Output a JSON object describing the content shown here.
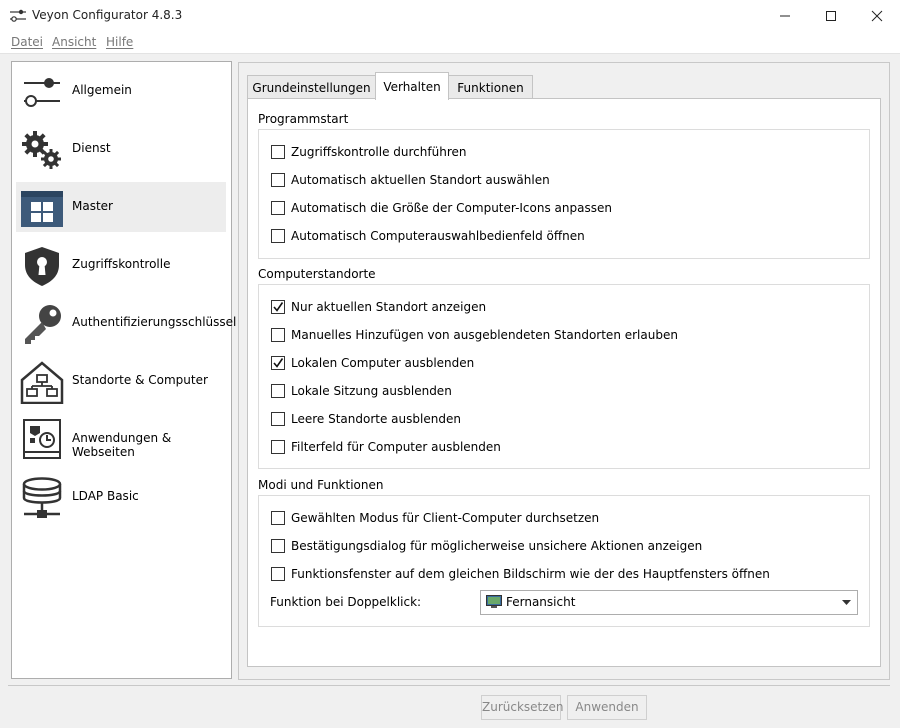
{
  "window": {
    "title": "Veyon Configurator 4.8.3"
  },
  "menu": [
    "Datei",
    "Ansicht",
    "Hilfe"
  ],
  "sidebar": {
    "items": [
      {
        "label": "Allgemein",
        "icon": "sliders-icon"
      },
      {
        "label": "Dienst",
        "icon": "gears-icon"
      },
      {
        "label": "Master",
        "icon": "master-grid-icon",
        "selected": true
      },
      {
        "label": "Zugriffskontrolle",
        "icon": "shield-keyhole-icon"
      },
      {
        "label": "Authentifizierungsschlüssel",
        "icon": "key-icon"
      },
      {
        "label": "Standorte & Computer",
        "icon": "house-network-icon"
      },
      {
        "label": "Anwendungen & Webseiten",
        "icon": "app-clock-icon"
      },
      {
        "label": "LDAP Basic",
        "icon": "database-network-icon"
      }
    ]
  },
  "tabs": [
    {
      "label": "Grundeinstellungen"
    },
    {
      "label": "Verhalten",
      "active": true
    },
    {
      "label": "Funktionen"
    }
  ],
  "groups": {
    "programmstart": {
      "title": "Programmstart",
      "options": [
        {
          "label": "Zugriffskontrolle durchführen",
          "checked": false
        },
        {
          "label": "Automatisch aktuellen Standort auswählen",
          "checked": false
        },
        {
          "label": "Automatisch die Größe der Computer-Icons anpassen",
          "checked": false
        },
        {
          "label": "Automatisch Computerauswahlbedienfeld öffnen",
          "checked": false
        }
      ]
    },
    "computerstandorte": {
      "title": "Computerstandorte",
      "options": [
        {
          "label": "Nur aktuellen Standort anzeigen",
          "checked": true
        },
        {
          "label": "Manuelles Hinzufügen von ausgeblendeten Standorten erlauben",
          "checked": false
        },
        {
          "label": "Lokalen Computer ausblenden",
          "checked": true
        },
        {
          "label": "Lokale Sitzung ausblenden",
          "checked": false
        },
        {
          "label": "Leere Standorte ausblenden",
          "checked": false
        },
        {
          "label": "Filterfeld für Computer ausblenden",
          "checked": false
        }
      ]
    },
    "modi": {
      "title": "Modi und Funktionen",
      "options": [
        {
          "label": "Gewählten Modus für Client-Computer durchsetzen",
          "checked": false
        },
        {
          "label": "Bestätigungsdialog für möglicherweise unsichere Aktionen anzeigen",
          "checked": false
        },
        {
          "label": "Funktionsfenster auf dem gleichen Bildschirm wie der des Hauptfensters öffnen",
          "checked": false
        }
      ],
      "doubleclick_label": "Funktion bei Doppelklick:",
      "doubleclick_value": "Fernansicht",
      "doubleclick_icon": "monitor-icon"
    }
  },
  "buttons": {
    "reset": "Zurücksetzen",
    "apply": "Anwenden"
  }
}
